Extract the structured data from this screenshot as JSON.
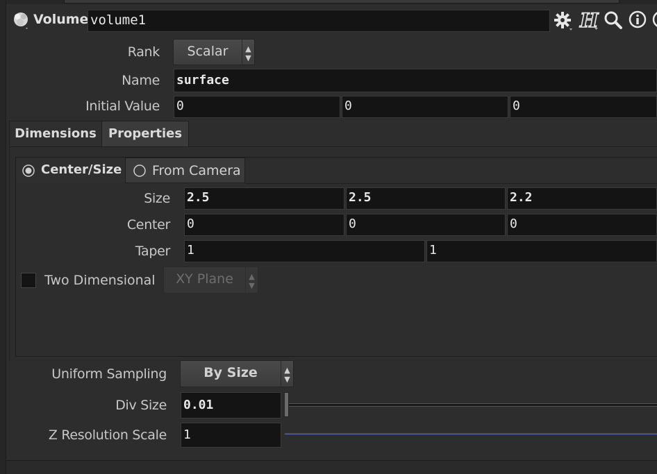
{
  "header": {
    "node_type": "Volume",
    "node_name": "volume1"
  },
  "params": {
    "rank": {
      "label": "Rank",
      "value": "Scalar"
    },
    "name": {
      "label": "Name",
      "value": "surface"
    },
    "initial_value": {
      "label": "Initial Value",
      "values": [
        "0",
        "0",
        "0"
      ]
    }
  },
  "tabs": [
    {
      "label": "Dimensions",
      "active": true
    },
    {
      "label": "Properties",
      "active": false
    }
  ],
  "mode": {
    "options": [
      {
        "label": "Center/Size",
        "selected": true
      },
      {
        "label": "From Camera",
        "selected": false
      }
    ]
  },
  "dimensions": {
    "size": {
      "label": "Size",
      "values": [
        "2.5",
        "2.5",
        "2.2"
      ]
    },
    "center": {
      "label": "Center",
      "values": [
        "0",
        "0",
        "0"
      ]
    },
    "taper": {
      "label": "Taper",
      "values": [
        "1",
        "1"
      ]
    },
    "two_dimensional": {
      "label": "Two Dimensional",
      "checked": false,
      "plane": "XY Plane"
    }
  },
  "sampling": {
    "uniform": {
      "label": "Uniform Sampling",
      "value": "By Size"
    },
    "div_size": {
      "label": "Div Size",
      "value": "0.01"
    },
    "z_res": {
      "label": "Z Resolution Scale",
      "value": "1"
    }
  },
  "colors": {
    "panel_bg": "#2d2d2d",
    "field_bg": "#141414",
    "slider_accent": "#3a4a8a"
  }
}
